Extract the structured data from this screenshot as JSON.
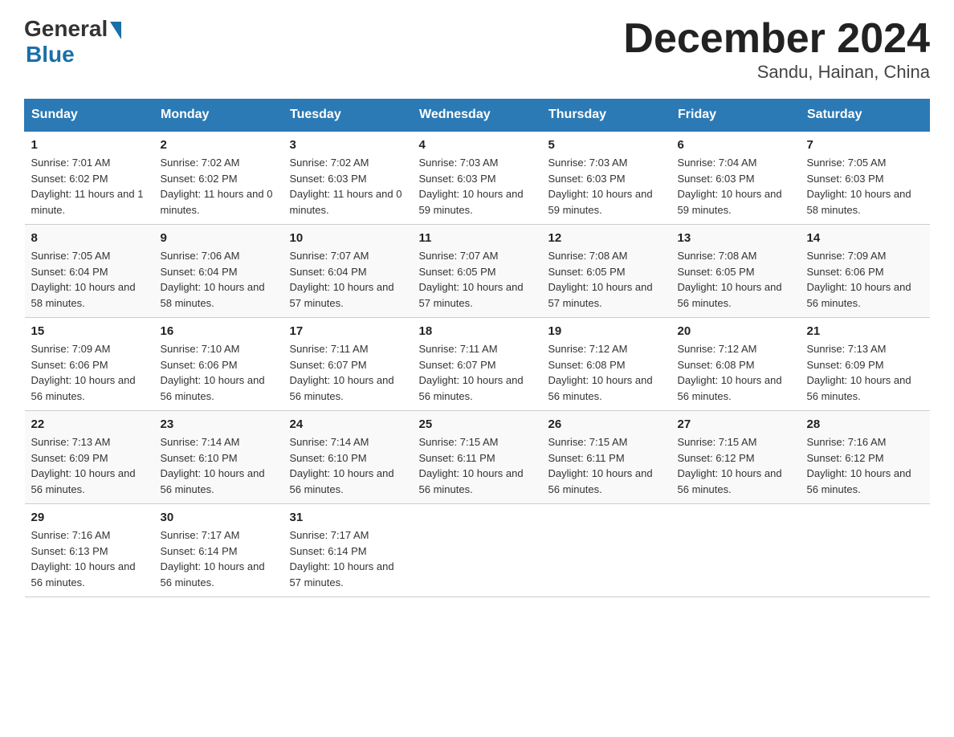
{
  "logo": {
    "text_general": "General",
    "text_blue": "Blue"
  },
  "title": "December 2024",
  "subtitle": "Sandu, Hainan, China",
  "days_of_week": [
    "Sunday",
    "Monday",
    "Tuesday",
    "Wednesday",
    "Thursday",
    "Friday",
    "Saturday"
  ],
  "weeks": [
    [
      {
        "day": "1",
        "sunrise": "7:01 AM",
        "sunset": "6:02 PM",
        "daylight": "11 hours and 1 minute."
      },
      {
        "day": "2",
        "sunrise": "7:02 AM",
        "sunset": "6:02 PM",
        "daylight": "11 hours and 0 minutes."
      },
      {
        "day": "3",
        "sunrise": "7:02 AM",
        "sunset": "6:03 PM",
        "daylight": "11 hours and 0 minutes."
      },
      {
        "day": "4",
        "sunrise": "7:03 AM",
        "sunset": "6:03 PM",
        "daylight": "10 hours and 59 minutes."
      },
      {
        "day": "5",
        "sunrise": "7:03 AM",
        "sunset": "6:03 PM",
        "daylight": "10 hours and 59 minutes."
      },
      {
        "day": "6",
        "sunrise": "7:04 AM",
        "sunset": "6:03 PM",
        "daylight": "10 hours and 59 minutes."
      },
      {
        "day": "7",
        "sunrise": "7:05 AM",
        "sunset": "6:03 PM",
        "daylight": "10 hours and 58 minutes."
      }
    ],
    [
      {
        "day": "8",
        "sunrise": "7:05 AM",
        "sunset": "6:04 PM",
        "daylight": "10 hours and 58 minutes."
      },
      {
        "day": "9",
        "sunrise": "7:06 AM",
        "sunset": "6:04 PM",
        "daylight": "10 hours and 58 minutes."
      },
      {
        "day": "10",
        "sunrise": "7:07 AM",
        "sunset": "6:04 PM",
        "daylight": "10 hours and 57 minutes."
      },
      {
        "day": "11",
        "sunrise": "7:07 AM",
        "sunset": "6:05 PM",
        "daylight": "10 hours and 57 minutes."
      },
      {
        "day": "12",
        "sunrise": "7:08 AM",
        "sunset": "6:05 PM",
        "daylight": "10 hours and 57 minutes."
      },
      {
        "day": "13",
        "sunrise": "7:08 AM",
        "sunset": "6:05 PM",
        "daylight": "10 hours and 56 minutes."
      },
      {
        "day": "14",
        "sunrise": "7:09 AM",
        "sunset": "6:06 PM",
        "daylight": "10 hours and 56 minutes."
      }
    ],
    [
      {
        "day": "15",
        "sunrise": "7:09 AM",
        "sunset": "6:06 PM",
        "daylight": "10 hours and 56 minutes."
      },
      {
        "day": "16",
        "sunrise": "7:10 AM",
        "sunset": "6:06 PM",
        "daylight": "10 hours and 56 minutes."
      },
      {
        "day": "17",
        "sunrise": "7:11 AM",
        "sunset": "6:07 PM",
        "daylight": "10 hours and 56 minutes."
      },
      {
        "day": "18",
        "sunrise": "7:11 AM",
        "sunset": "6:07 PM",
        "daylight": "10 hours and 56 minutes."
      },
      {
        "day": "19",
        "sunrise": "7:12 AM",
        "sunset": "6:08 PM",
        "daylight": "10 hours and 56 minutes."
      },
      {
        "day": "20",
        "sunrise": "7:12 AM",
        "sunset": "6:08 PM",
        "daylight": "10 hours and 56 minutes."
      },
      {
        "day": "21",
        "sunrise": "7:13 AM",
        "sunset": "6:09 PM",
        "daylight": "10 hours and 56 minutes."
      }
    ],
    [
      {
        "day": "22",
        "sunrise": "7:13 AM",
        "sunset": "6:09 PM",
        "daylight": "10 hours and 56 minutes."
      },
      {
        "day": "23",
        "sunrise": "7:14 AM",
        "sunset": "6:10 PM",
        "daylight": "10 hours and 56 minutes."
      },
      {
        "day": "24",
        "sunrise": "7:14 AM",
        "sunset": "6:10 PM",
        "daylight": "10 hours and 56 minutes."
      },
      {
        "day": "25",
        "sunrise": "7:15 AM",
        "sunset": "6:11 PM",
        "daylight": "10 hours and 56 minutes."
      },
      {
        "day": "26",
        "sunrise": "7:15 AM",
        "sunset": "6:11 PM",
        "daylight": "10 hours and 56 minutes."
      },
      {
        "day": "27",
        "sunrise": "7:15 AM",
        "sunset": "6:12 PM",
        "daylight": "10 hours and 56 minutes."
      },
      {
        "day": "28",
        "sunrise": "7:16 AM",
        "sunset": "6:12 PM",
        "daylight": "10 hours and 56 minutes."
      }
    ],
    [
      {
        "day": "29",
        "sunrise": "7:16 AM",
        "sunset": "6:13 PM",
        "daylight": "10 hours and 56 minutes."
      },
      {
        "day": "30",
        "sunrise": "7:17 AM",
        "sunset": "6:14 PM",
        "daylight": "10 hours and 56 minutes."
      },
      {
        "day": "31",
        "sunrise": "7:17 AM",
        "sunset": "6:14 PM",
        "daylight": "10 hours and 57 minutes."
      },
      null,
      null,
      null,
      null
    ]
  ]
}
